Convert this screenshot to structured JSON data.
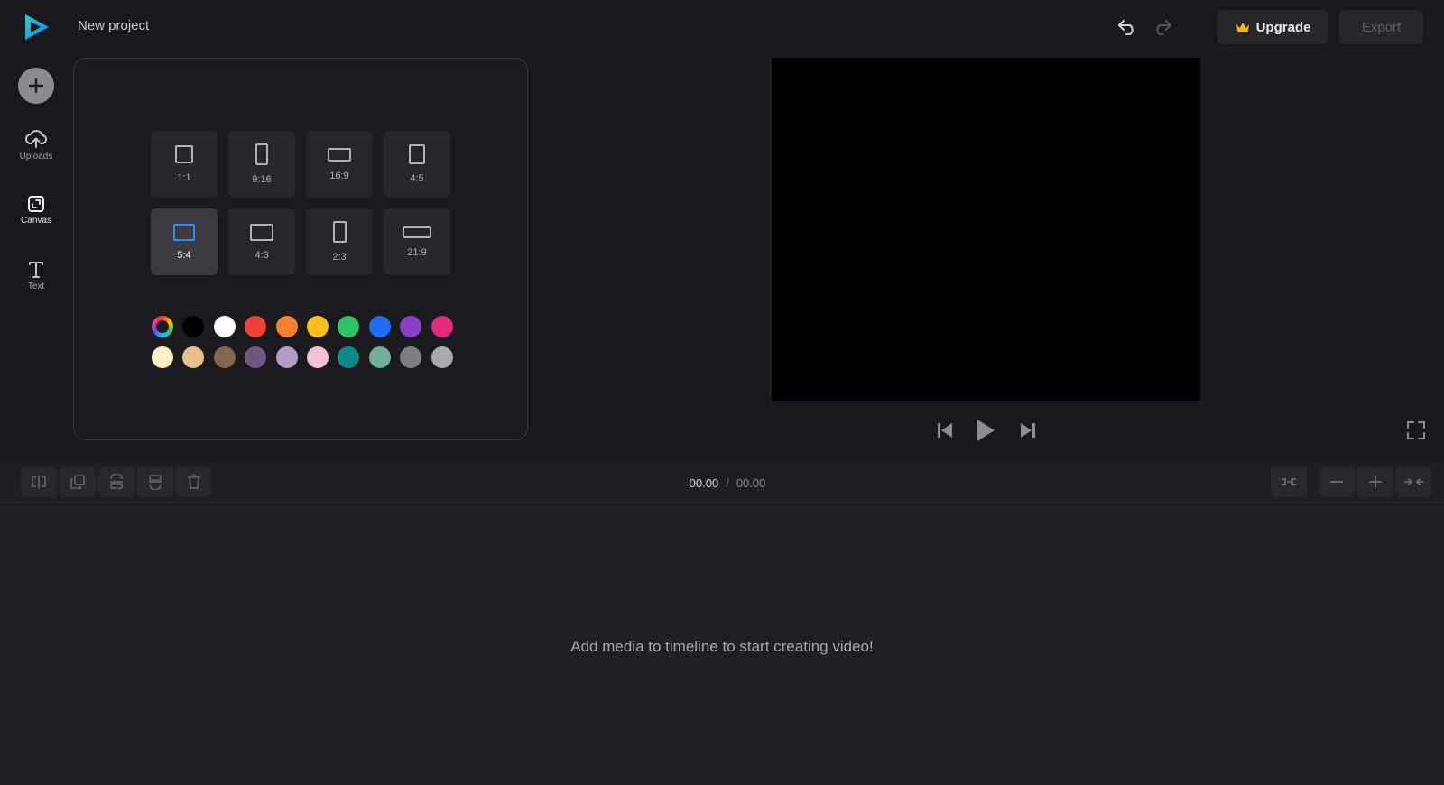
{
  "header": {
    "project_title": "New project",
    "upgrade_label": "Upgrade",
    "export_label": "Export",
    "icons": {
      "undo": "undo-icon",
      "redo": "redo-icon",
      "crown": "crown-icon"
    }
  },
  "sidebar": {
    "add_icon": "plus-icon",
    "items": [
      {
        "label": "Uploads",
        "icon": "cloud-upload-icon",
        "active": false
      },
      {
        "label": "Canvas",
        "icon": "resize-icon",
        "active": true
      },
      {
        "label": "Text",
        "icon": "text-icon",
        "active": false
      }
    ]
  },
  "canvas_panel": {
    "ratios": [
      {
        "label": "1:1",
        "selected": false
      },
      {
        "label": "9:16",
        "selected": false
      },
      {
        "label": "16:9",
        "selected": false
      },
      {
        "label": "4:5",
        "selected": false
      },
      {
        "label": "5:4",
        "selected": true
      },
      {
        "label": "4:3",
        "selected": false
      },
      {
        "label": "2:3",
        "selected": false
      },
      {
        "label": "21:9",
        "selected": false
      }
    ],
    "colors": [
      "color-wheel",
      "#000000",
      "#ffffff",
      "#ef4136",
      "#f7812d",
      "#fbbf1e",
      "#2ec463",
      "#1e6ef4",
      "#8b3ec8",
      "#e12a7d",
      "#fff1c4",
      "#e9c08c",
      "#80694f",
      "#6f577f",
      "#b79bc7",
      "#f2c3d6",
      "#0c8a88",
      "#6fae97",
      "#7b7d80",
      "#a8aaad"
    ],
    "accent_color": "#2f8ef5"
  },
  "preview": {
    "background": "#000000",
    "icons": {
      "previous": "skip-back-icon",
      "play": "play-icon",
      "next": "skip-forward-icon",
      "fullscreen": "fullscreen-icon"
    }
  },
  "toolbar": {
    "current_time": "00.00",
    "separator": "/",
    "total_time": "00.00",
    "tools": [
      "split-icon",
      "duplicate-icon",
      "align-bottom-icon",
      "align-top-icon",
      "trash-icon"
    ],
    "zoom_tools": [
      "fit-icon",
      "zoom-out-icon",
      "zoom-in-icon",
      "collapse-icon"
    ]
  },
  "timeline": {
    "empty_message": "Add media to timeline to start creating video!"
  }
}
